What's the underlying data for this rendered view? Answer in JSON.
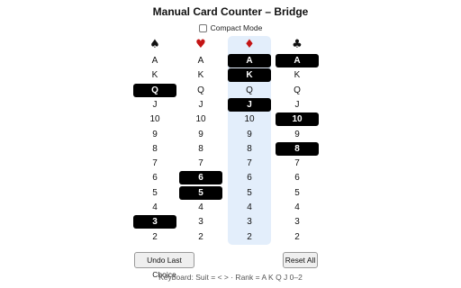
{
  "title": "Manual Card Counter – Bridge",
  "compact_mode": {
    "label": "Compact Mode",
    "checked": false
  },
  "active_suit": "diamonds",
  "columns": [
    {
      "id": "spades",
      "glyph": "♠",
      "color": "#111111",
      "ranks": [
        "A",
        "K",
        "Q",
        "J",
        "10",
        "9",
        "8",
        "7",
        "6",
        "5",
        "4",
        "3",
        "2"
      ],
      "selected": [
        "Q",
        "3"
      ]
    },
    {
      "id": "hearts",
      "glyph": "♥",
      "color": "#c41414",
      "ranks": [
        "A",
        "K",
        "Q",
        "J",
        "10",
        "9",
        "8",
        "7",
        "6",
        "5",
        "4",
        "3",
        "2"
      ],
      "selected": [
        "6",
        "5"
      ]
    },
    {
      "id": "diamonds",
      "glyph": "♦",
      "color": "#c41414",
      "ranks": [
        "A",
        "K",
        "Q",
        "J",
        "10",
        "9",
        "8",
        "7",
        "6",
        "5",
        "4",
        "3",
        "2"
      ],
      "selected": [
        "A",
        "K",
        "J"
      ]
    },
    {
      "id": "clubs",
      "glyph": "♣",
      "color": "#111111",
      "ranks": [
        "A",
        "K",
        "Q",
        "J",
        "10",
        "9",
        "8",
        "7",
        "6",
        "5",
        "4",
        "3",
        "2"
      ],
      "selected": [
        "A",
        "10",
        "8"
      ]
    }
  ],
  "buttons": {
    "undo": "Undo Last Choice",
    "reset": "Reset All"
  },
  "keyboard_hint": "Keyboard: Suit = < > · Rank = A K Q J 0–2",
  "colors": {
    "selected_bg": "#000000",
    "active_column_bg": "#e3eefb",
    "red_suit": "#c41414"
  }
}
